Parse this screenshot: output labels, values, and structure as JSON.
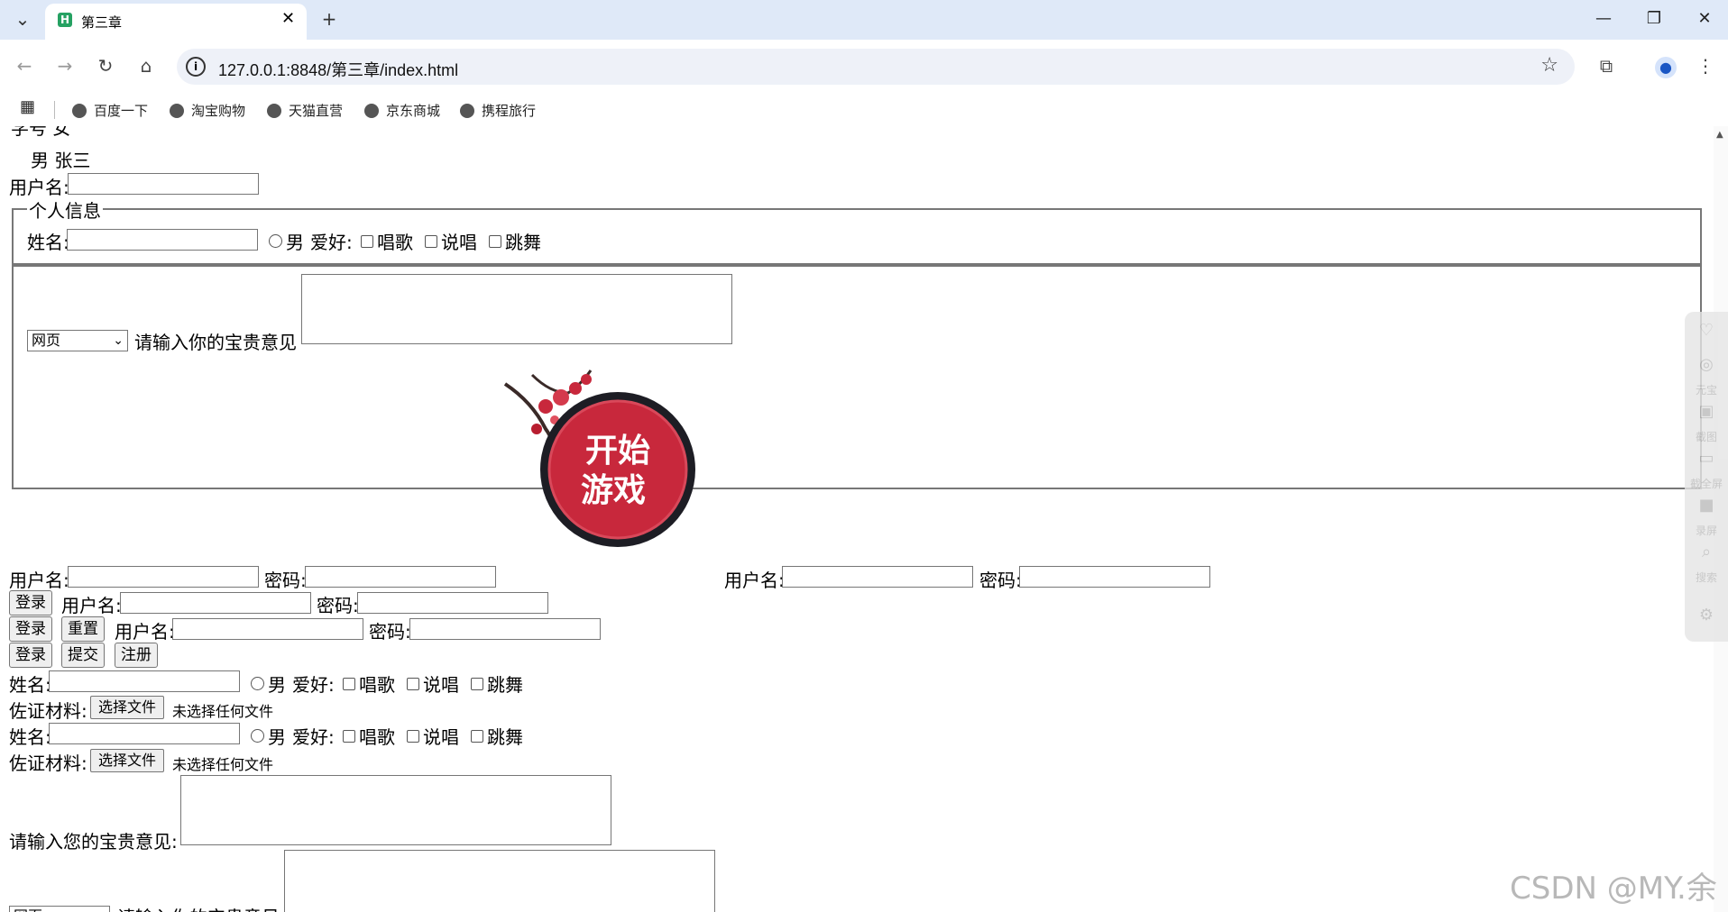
{
  "browser": {
    "tab_title": "第三章",
    "favicon_letter": "H",
    "url": "127.0.0.1:8848/第三章/index.html",
    "bookmarks": [
      "百度一下",
      "淘宝购物",
      "天猫直营",
      "京东商城",
      "携程旅行"
    ]
  },
  "page": {
    "top_cut_text": "学号  女",
    "row_gender_name": "男  张三",
    "username_label": "用户名:",
    "fieldset_personal": {
      "legend": "个人信息",
      "name_label": "姓名:",
      "gender_male": "男",
      "hobby_label": "爱好:",
      "hobby_sing": "唱歌",
      "hobby_rap": "说唱",
      "hobby_dance": "跳舞"
    },
    "fieldset_feedback": {
      "select_value": "网页",
      "feedback_label": "请输入你的宝贵意见"
    },
    "game_image_text": [
      "开始",
      "游戏"
    ],
    "login_row1": {
      "user": "用户名:",
      "pass": "密码:",
      "user2": "用户名:",
      "pass2": "密码:"
    },
    "login_row2": {
      "login": "登录",
      "user": "用户名:",
      "pass": "密码:"
    },
    "login_row3": {
      "login": "登录",
      "reset": "重置",
      "user": "用户名:",
      "pass": "密码:"
    },
    "login_row4": {
      "login": "登录",
      "submit": "提交",
      "register": "注册"
    },
    "form_block1": {
      "name_label": "姓名:",
      "gender_male": "男",
      "hobby_label": "爱好:",
      "hobby_sing": "唱歌",
      "hobby_rap": "说唱",
      "hobby_dance": "跳舞",
      "evidence_label": "佐证材料:",
      "choose_file": "选择文件",
      "no_file": "未选择任何文件"
    },
    "form_block2": {
      "name_label": "姓名:",
      "gender_male": "男",
      "hobby_label": "爱好:",
      "hobby_sing": "唱歌",
      "hobby_rap": "说唱",
      "hobby_dance": "跳舞",
      "evidence_label": "佐证材料:",
      "choose_file": "选择文件",
      "no_file": "未选择任何文件"
    },
    "feedback2_label": "请输入您的宝贵意见:",
    "bottom_cut": {
      "select_value": "网页",
      "feedback_label": "请输入你的宝贵意见"
    }
  },
  "sidebar": {
    "items": [
      "元宝",
      "截图",
      "截全屏",
      "录屏",
      "搜索"
    ]
  },
  "watermark": "CSDN @MY.余",
  "colors": {
    "tab_strip": "#dfe9f8",
    "omnibox": "#eef1f8",
    "favicon": "#25a162",
    "game_red": "#c8283c"
  }
}
